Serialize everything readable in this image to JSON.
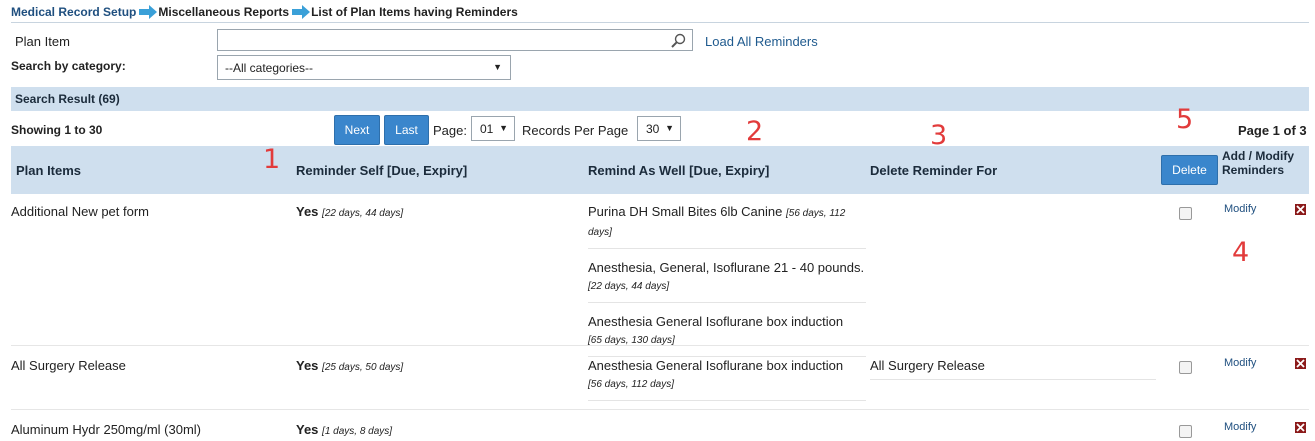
{
  "breadcrumb": [
    "Medical Record Setup",
    "Miscellaneous Reports",
    "List of Plan Items having Reminders"
  ],
  "search": {
    "plan_item_label": "Plan Item",
    "plan_item_value": "",
    "load_all_label": "Load All Reminders",
    "category_label": "Search by category:",
    "category_value": "--All categories--"
  },
  "result_header": "Search Result (69)",
  "pager": {
    "showing": "Showing 1 to 30",
    "next_label": "Next",
    "last_label": "Last",
    "page_label": "Page:",
    "page_value": "01",
    "rpp_label": "Records Per Page",
    "rpp_value": "30",
    "page_of": "Page 1 of 3"
  },
  "annotations": [
    "1",
    "2",
    "3",
    "4",
    "5"
  ],
  "columns": {
    "plan_items": "Plan Items",
    "reminder_self": "Reminder Self [Due, Expiry]",
    "remind_as_well": "Remind As Well [Due, Expiry]",
    "delete_for": "Delete Reminder For",
    "delete_button": "Delete",
    "add_modify": "Add / Modify Reminders"
  },
  "rows": [
    {
      "plan_item": "Additional New pet form",
      "self_yes": "Yes",
      "self_detail": "[22 days, 44 days]",
      "remind_as_well": [
        {
          "name": "Purina DH Small Bites 6lb Canine",
          "detail": "[56 days, 112 days]"
        },
        {
          "name": "Anesthesia, General, Isoflurane 21 - 40 pounds.",
          "detail": "[22 days, 44 days]"
        },
        {
          "name": "Anesthesia General Isoflurane box induction",
          "detail": "[65 days, 130 days]"
        }
      ],
      "delete_for": "",
      "modify_label": "Modify"
    },
    {
      "plan_item": "All Surgery Release",
      "self_yes": "Yes",
      "self_detail": "[25 days, 50 days]",
      "remind_as_well": [
        {
          "name": "Anesthesia General Isoflurane box induction",
          "detail": "[56 days, 112 days]"
        }
      ],
      "delete_for": "All Surgery Release",
      "modify_label": "Modify"
    },
    {
      "plan_item": "Aluminum Hydr 250mg/ml (30ml)",
      "self_yes": "Yes",
      "self_detail": "[1 days, 8 days]",
      "remind_as_well": [],
      "delete_for": "",
      "modify_label": "Modify"
    }
  ],
  "colors": {
    "header_bg": "#cfdfee",
    "button_blue": "#3a86cc",
    "link": "#1f5a8e",
    "annotation_red": "#e23b3b",
    "delete_x": "#8b1a1a"
  },
  "icons": [
    "arrow-right-icon",
    "search-icon",
    "chevron-down-icon",
    "close-icon"
  ]
}
